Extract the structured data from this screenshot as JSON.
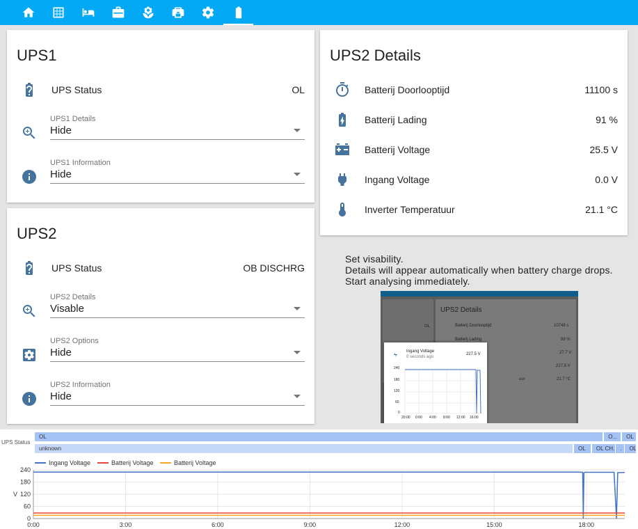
{
  "toolbar": {
    "tabs": [
      {
        "icon": "home-icon"
      },
      {
        "icon": "solar-panel-icon"
      },
      {
        "icon": "bed-icon"
      },
      {
        "icon": "briefcase-icon"
      },
      {
        "icon": "flower-icon"
      },
      {
        "icon": "printer-3d-icon"
      },
      {
        "icon": "gear-icon"
      },
      {
        "icon": "battery-icon",
        "active": true
      }
    ],
    "color": "#03a9f4"
  },
  "ups1": {
    "title": "UPS1",
    "status_label": "UPS Status",
    "status_value": "OL",
    "details": {
      "label": "UPS1 Details",
      "value": "Hide"
    },
    "information": {
      "label": "UPS1 Information",
      "value": "Hide"
    }
  },
  "ups2": {
    "title": "UPS2",
    "status_label": "UPS Status",
    "status_value": "OB DISCHRG",
    "details": {
      "label": "UPS2 Details",
      "value": "Visable"
    },
    "options": {
      "label": "UPS2 Options",
      "value": "Hide"
    },
    "information": {
      "label": "UPS2 Information",
      "value": "Hide"
    }
  },
  "ups2_details": {
    "title": "UPS2 Details",
    "rows": [
      {
        "icon": "timer-icon",
        "label": "Batterij Doorlooptijd",
        "value": "11100 s"
      },
      {
        "icon": "battery-charging-icon",
        "label": "Batterij Lading",
        "value": "91 %"
      },
      {
        "icon": "car-battery-icon",
        "label": "Batterij Voltage",
        "value": "25.5 V"
      },
      {
        "icon": "power-plug-icon",
        "label": "Ingang Voltage",
        "value": "0.0 V"
      },
      {
        "icon": "thermometer-icon",
        "label": "Inverter Temperatuur",
        "value": "21.1 °C"
      }
    ]
  },
  "info": {
    "line1": "Set visability.",
    "line2": "Details will appear automatically when battery charge drops.",
    "line3": "Start analysing immediately."
  },
  "thumbnail": {
    "title": "UPS2 Details",
    "left_value": "OL",
    "rows": [
      {
        "label": "Batterij Doorlooptijd",
        "value": "10748 s"
      },
      {
        "label": "Batterij Lading",
        "value": "89 %"
      },
      {
        "label": "",
        "value": "27.7 V"
      },
      {
        "label": "",
        "value": "227.5 V"
      },
      {
        "label": "uur",
        "value": "21.7 °C"
      }
    ],
    "popup": {
      "title": "Ingang Voltage",
      "subtitle": "0 seconds ago",
      "value": "227.5 V",
      "y_ticks": [
        "240",
        "180",
        "120",
        "60",
        "0"
      ],
      "x_ticks": [
        "20:00",
        "0:00",
        "4:00",
        "8:00",
        "12:00",
        "16:00"
      ]
    }
  },
  "timeline": {
    "label": "UPS Status",
    "row1": [
      {
        "text": "OL",
        "start": 0.0,
        "end": 0.945,
        "color": "#a4c2f4"
      },
      {
        "text": "O...",
        "start": 0.947,
        "end": 0.975,
        "color": "#a4c2f4"
      },
      {
        "text": "OL",
        "start": 0.977,
        "end": 1.0,
        "color": "#a4c2f4"
      }
    ],
    "row2": [
      {
        "text": "unknown",
        "start": 0.0,
        "end": 0.895,
        "color": "#c5d8f8"
      },
      {
        "text": "OL",
        "start": 0.897,
        "end": 0.925,
        "color": "#a4c2f4"
      },
      {
        "text": "OL CH...",
        "start": 0.927,
        "end": 0.965,
        "color": "#a4c2f4"
      },
      {
        "text": ".",
        "start": 0.967,
        "end": 0.98,
        "color": "#a4c2f4"
      },
      {
        "text": "OL",
        "start": 0.982,
        "end": 1.0,
        "color": "#a4c2f4"
      }
    ]
  },
  "chart_data": {
    "type": "line",
    "ylabel": "V",
    "ylim": [
      0,
      240
    ],
    "y_ticks": [
      0,
      60,
      120,
      180,
      240
    ],
    "x_range": [
      0,
      19.25
    ],
    "x_ticks": [
      {
        "label": "0:00",
        "value": 0
      },
      {
        "label": "3:00",
        "value": 3
      },
      {
        "label": "6:00",
        "value": 6
      },
      {
        "label": "9:00",
        "value": 9
      },
      {
        "label": "12:00",
        "value": 12
      },
      {
        "label": "15:00",
        "value": 15
      },
      {
        "label": "18:00",
        "value": 18
      }
    ],
    "grid": true,
    "legend": "top-left",
    "series": [
      {
        "name": "Ingang Voltage",
        "color": "#4472c4",
        "x": [
          0,
          2,
          4,
          6,
          8,
          10,
          12,
          14,
          16,
          17.7,
          17.88,
          17.9,
          17.92,
          17.95,
          18.1,
          18.5,
          18.9,
          18.98,
          19.02,
          19.25
        ],
        "y": [
          229,
          229,
          229,
          229,
          229,
          229,
          229,
          229,
          229,
          229,
          228,
          0,
          225,
          228,
          228,
          228,
          228,
          0,
          226,
          227
        ]
      },
      {
        "name": "Batterij Voltage",
        "color": "#e8453c",
        "x": [
          0,
          19.25
        ],
        "y": [
          27.5,
          27.5
        ]
      },
      {
        "name": "Batterij Voltage",
        "color": "#f5a623",
        "x": [
          0,
          19.25
        ],
        "y": [
          16,
          16
        ]
      }
    ]
  }
}
